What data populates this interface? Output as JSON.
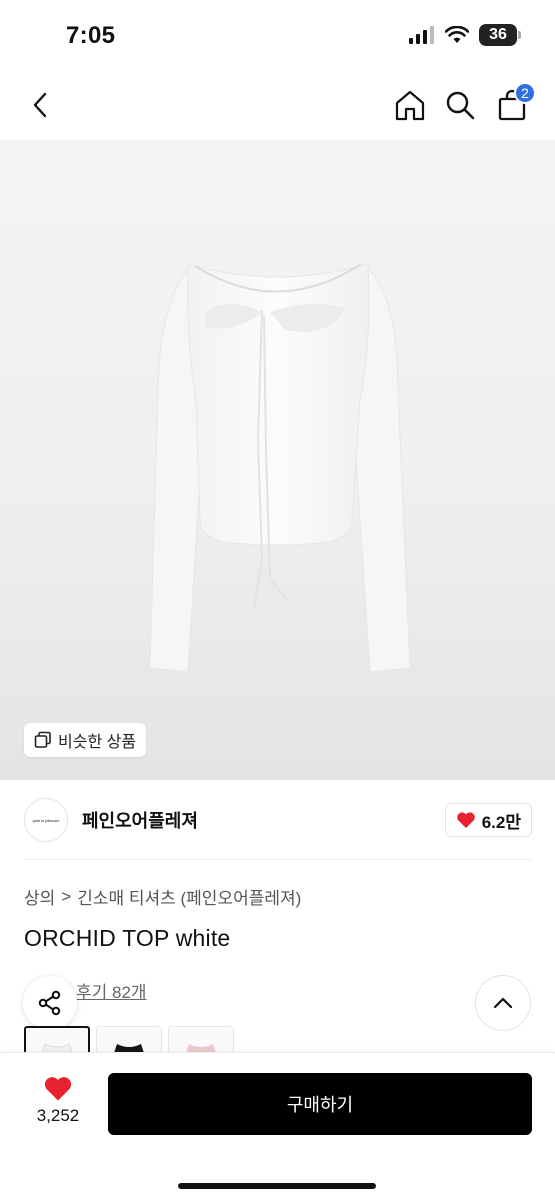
{
  "status": {
    "time": "7:05",
    "battery": "36"
  },
  "nav": {
    "cart_count": "2"
  },
  "hero": {
    "similar_label": "비슷한 상품"
  },
  "brand": {
    "name": "페인오어플레져",
    "logo_text": "pain or pleasure",
    "likes": "6.2만"
  },
  "breadcrumb": {
    "category": "상의",
    "separator": ">",
    "subcategory": "긴소매 티셔츠 (페인오어플레져)"
  },
  "product": {
    "title": "ORCHID TOP white"
  },
  "reviews": {
    "label": "후기 82개"
  },
  "colors": {
    "accent": "#2f6fe4",
    "heart": "#e8212e",
    "options": [
      "white",
      "black",
      "pink"
    ]
  },
  "bottom": {
    "wish_count": "3,252",
    "buy_label": "구매하기"
  }
}
